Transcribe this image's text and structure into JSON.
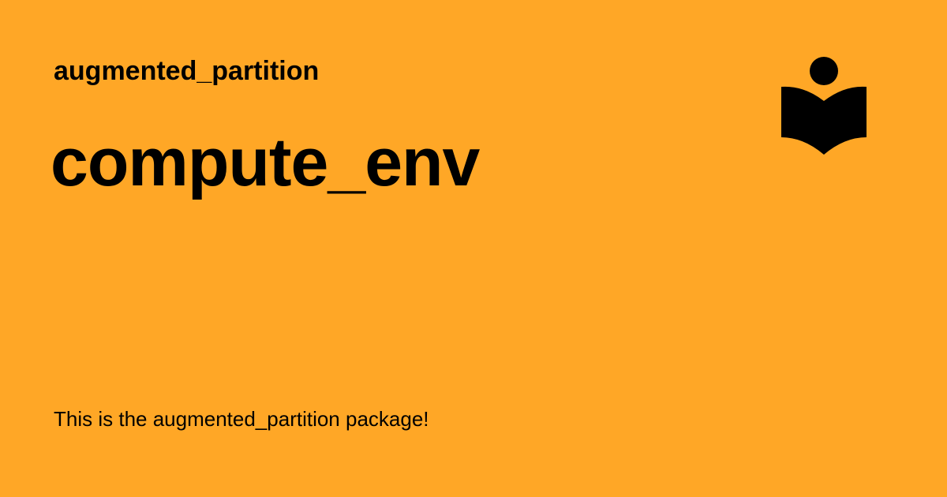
{
  "header": {
    "site_name": "augmented_partition"
  },
  "main": {
    "title": "compute_env",
    "description": "This is the augmented_partition package!"
  },
  "logo": {
    "icon": "reader-book-icon"
  },
  "colors": {
    "background": "#FFA726",
    "text": "#000000"
  }
}
